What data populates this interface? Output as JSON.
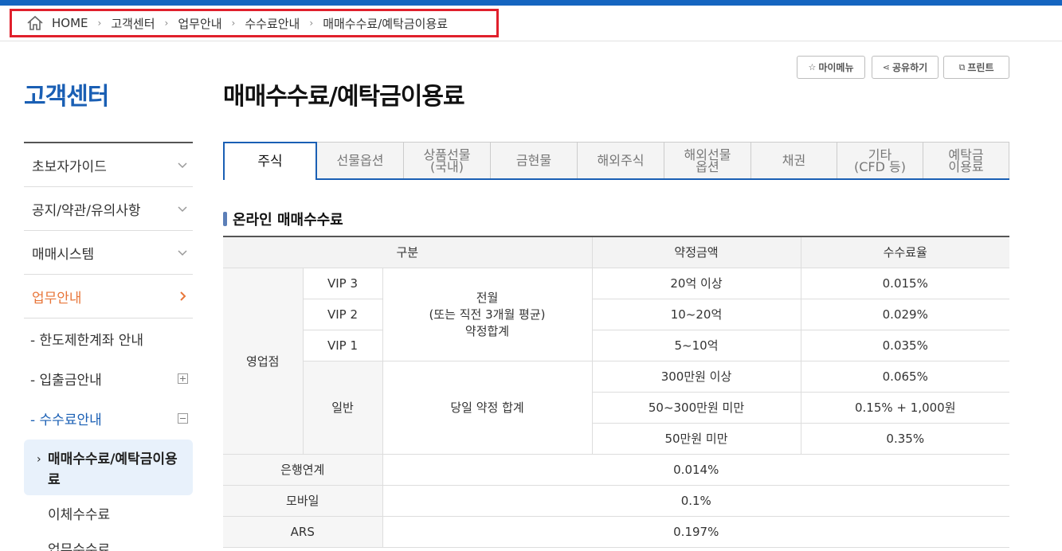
{
  "breadcrumb": {
    "items": [
      "HOME",
      "고객센터",
      "업무안내",
      "수수료안내",
      "매매수수료/예탁금이용료"
    ],
    "separator": "›"
  },
  "sidebar": {
    "title": "고객센터",
    "items": [
      {
        "label": "초보자가이드"
      },
      {
        "label": "공지/약관/유의사항"
      },
      {
        "label": "매매시스템"
      },
      {
        "label": "업무안내"
      }
    ],
    "sub": [
      {
        "label": "- 한도제한계좌 안내"
      },
      {
        "label": "- 입출금안내"
      },
      {
        "label": "- 수수료안내"
      }
    ],
    "current": {
      "marker": "›",
      "label": "매매수수료/예탁금이용료"
    },
    "leaves": [
      {
        "label": "이체수수료"
      },
      {
        "label": "업무수수료"
      }
    ]
  },
  "page": {
    "title": "매매수수료/예탁금이용료"
  },
  "util": {
    "mymenu": "마이메뉴",
    "share": "공유하기",
    "print": "프린트"
  },
  "tabs": [
    {
      "line1": "주식",
      "line2": ""
    },
    {
      "line1": "선물옵션",
      "line2": ""
    },
    {
      "line1": "상품선물",
      "line2": "(국내)"
    },
    {
      "line1": "금현물",
      "line2": ""
    },
    {
      "line1": "해외주식",
      "line2": ""
    },
    {
      "line1": "해외선물",
      "line2": "옵션"
    },
    {
      "line1": "채권",
      "line2": ""
    },
    {
      "line1": "기타",
      "line2": "(CFD 등)"
    },
    {
      "line1": "예탁금",
      "line2": "이용료"
    }
  ],
  "section": {
    "title": "온라인 매매수수료"
  },
  "table": {
    "headers": [
      "구분",
      "약정금액",
      "수수료율"
    ],
    "branch": "영업점",
    "vip": [
      {
        "grade": "VIP 3",
        "amount": "20억 이상",
        "rate": "0.015%"
      },
      {
        "grade": "VIP 2",
        "amount": "10~20억",
        "rate": "0.029%"
      },
      {
        "grade": "VIP 1",
        "amount": "5~10억",
        "rate": "0.035%"
      }
    ],
    "vip_basis": {
      "l1": "전월",
      "l2": "(또는 직전 3개월 평균)",
      "l3": "약정합계"
    },
    "general": {
      "grade": "일반",
      "basis": "당일 약정 합계",
      "rows": [
        {
          "amount": "300만원 이상",
          "rate": "0.065%"
        },
        {
          "amount": "50~300만원 미만",
          "rate": "0.15% + 1,000원"
        },
        {
          "amount": "50만원 미만",
          "rate": "0.35%"
        }
      ]
    },
    "others": [
      {
        "label": "은행연계",
        "rate": "0.014%"
      },
      {
        "label": "모바일",
        "rate": "0.1%"
      },
      {
        "label": "ARS",
        "rate": "0.197%"
      }
    ]
  },
  "colors": {
    "brand": "#1a5fb4",
    "active_menu": "#e8763a",
    "highlight_border": "#e0202c"
  }
}
